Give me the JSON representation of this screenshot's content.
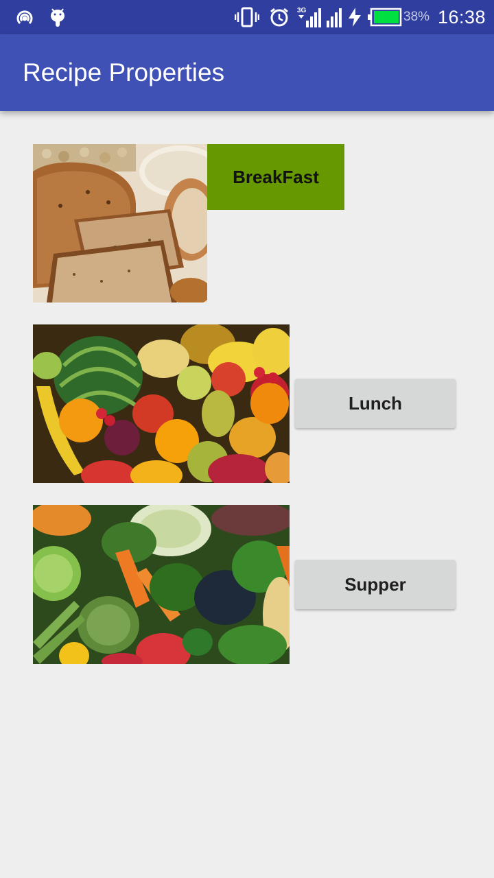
{
  "status_bar": {
    "battery_percent": "38%",
    "time": "16:38",
    "network_type": "3G",
    "icons": [
      "hotspot-icon",
      "android-debug-icon",
      "vibrate-icon",
      "alarm-icon",
      "signal-3g-icon",
      "signal-icon",
      "charging-icon",
      "battery-icon"
    ],
    "battery_level": 0.38,
    "colors": {
      "bar": "#303f9f",
      "battery_fill": "#00e040"
    }
  },
  "app_bar": {
    "title": "Recipe Properties",
    "color": "#3f51b5"
  },
  "meals": [
    {
      "image": "bread-image",
      "label": "BreakFast",
      "button_color": "#669900"
    },
    {
      "image": "fruits-image",
      "label": "Lunch",
      "button_color": "#d6d7d7"
    },
    {
      "image": "vegetables-image",
      "label": "Supper",
      "button_color": "#d6d7d7"
    }
  ],
  "background_color": "#eeeeee"
}
